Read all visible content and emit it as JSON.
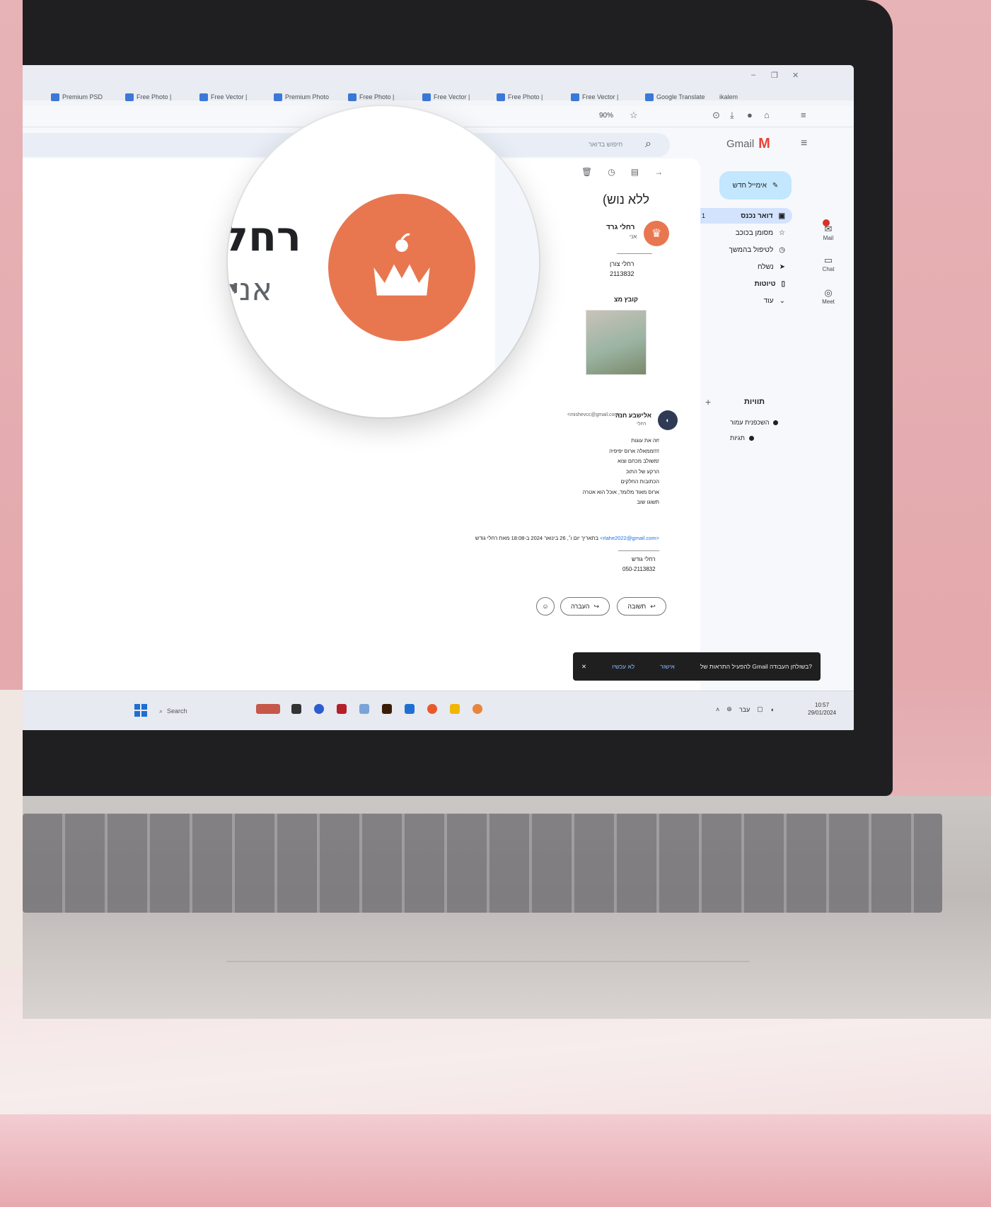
{
  "browser": {
    "tabs": [
      "Premium PSD",
      "Free Photo |",
      "Free Vector |",
      "Premium Photo",
      "Free Photo |",
      "Free Vector |",
      "Free Photo |",
      "Free Vector |",
      "Google Translate",
      "ikalem"
    ],
    "zoom": "90%"
  },
  "gmail": {
    "app_name": "Gmail",
    "search_placeholder": "חיפוש בדואר",
    "compose_label": "אימייל חדש",
    "nav": [
      {
        "label": "דואר נכנס",
        "count": "1",
        "icon": "inbox-icon"
      },
      {
        "label": "מסומן בכוכב",
        "icon": "star-icon"
      },
      {
        "label": "לטיפול בהמשך",
        "icon": "clock-icon"
      },
      {
        "label": "נשלח",
        "icon": "send-icon"
      },
      {
        "label": "טיוטות",
        "icon": "draft-icon"
      },
      {
        "label": "עוד",
        "icon": "chevron-down-icon"
      }
    ],
    "labels_heading": "תוויות",
    "labels": [
      "השכפנית עמור",
      "תגיות"
    ],
    "rail": [
      {
        "label": "Mail",
        "icon": "mail-icon"
      },
      {
        "label": "Chat",
        "icon": "chat-icon"
      },
      {
        "label": "Meet",
        "icon": "meet-icon"
      }
    ]
  },
  "message": {
    "subject": "(ללא נוש",
    "sender_name": "רחלי גרד",
    "sender_to": "אני",
    "signature": [
      "רחלי צורן",
      "2113832"
    ],
    "attachment_label": "קובץ מצ",
    "reply": {
      "name": "אלישבע חנה",
      "email": "<mishevcc@gmail.com>",
      "to": "רחלי",
      "lines": [
        "זה את עוגות!",
        "ממאלה ארוס יפיפיה!!!!",
        "משולב מכחם וצוא!",
        "הרקע של התוכ",
        "הכתובות החלקים",
        "ארוס מאוד מלומד, אוכל הוא אטרה",
        "תשוגו שוב"
      ]
    },
    "quote_prefix": "בתאריך יום ו׳, 26 בינואר 2024 ב-18:08 מאת רחלי גודש",
    "quote_link": "<rlahe2022@gmail.com>",
    "quote_sig": [
      "רחלי גודש",
      "050-2113832"
    ],
    "reply_button": "תשובה",
    "forward_button": "העברה"
  },
  "notification": {
    "text": "להפעיל התראות של Gmail בשולחן העבודה?",
    "allow": "אישור",
    "deny": "לא עכשיו"
  },
  "magnifier": {
    "name": "רחל",
    "sub": "אני"
  },
  "taskbar": {
    "search_label": "Search",
    "lang": "עבר",
    "time": "10:57",
    "date": "29/01/2024"
  }
}
